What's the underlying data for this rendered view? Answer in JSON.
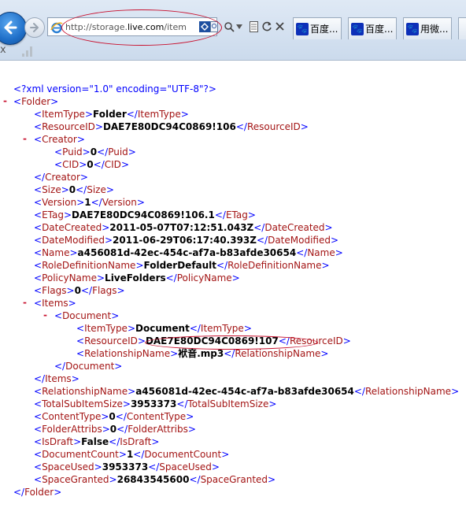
{
  "browser": {
    "url_prefix": "http://storage.",
    "url_domain": "live.com",
    "url_suffix": "/item",
    "tabs": [
      {
        "label": "百度..."
      },
      {
        "label": "百度..."
      },
      {
        "label": "用微..."
      }
    ],
    "close_glyph": "x"
  },
  "xml": {
    "declaration": "<?xml version=\"1.0\" encoding=\"UTF-8\"?>",
    "root": "Folder",
    "fields": {
      "ItemType": "Folder",
      "ResourceID": "DAE7E80DC94C0869!106",
      "Creator": {
        "Puid": "0",
        "CID": "0"
      },
      "Size": "0",
      "Version": "1",
      "ETag": "DAE7E80DC94C0869!106.1",
      "DateCreated": "2011-05-07T07:12:51.043Z",
      "DateModified": "2011-06-29T06:17:40.393Z",
      "Name": "a456081d-42ec-454c-af7a-b83afde30654",
      "RoleDefinitionName": "FolderDefault",
      "PolicyName": "LiveFolders",
      "Flags": "0",
      "Items": {
        "Document": {
          "ItemType": "Document",
          "ResourceID": "DAE7E80DC94C0869!107",
          "RelationshipName": "袱音.mp3"
        }
      },
      "RelationshipName": "a456081d-42ec-454c-af7a-b83afde30654",
      "TotalSubItemSize": "3953373",
      "ContentType": "0",
      "FolderAttribs": "0",
      "IsDraft": "False",
      "DocumentCount": "1",
      "SpaceUsed": "3953373",
      "SpaceGranted": "26843545600"
    }
  }
}
